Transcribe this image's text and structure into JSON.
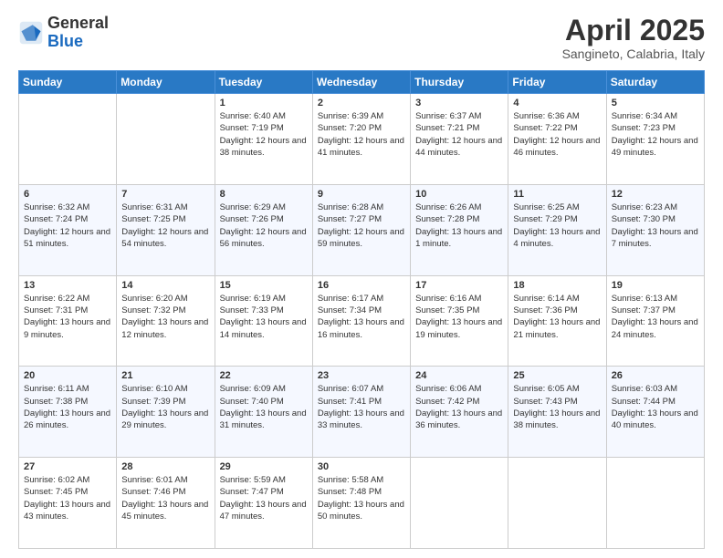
{
  "header": {
    "logo_general": "General",
    "logo_blue": "Blue",
    "title": "April 2025",
    "location": "Sangineto, Calabria, Italy"
  },
  "calendar": {
    "days_of_week": [
      "Sunday",
      "Monday",
      "Tuesday",
      "Wednesday",
      "Thursday",
      "Friday",
      "Saturday"
    ],
    "weeks": [
      [
        {
          "day": "",
          "content": ""
        },
        {
          "day": "",
          "content": ""
        },
        {
          "day": "1",
          "content": "Sunrise: 6:40 AM\nSunset: 7:19 PM\nDaylight: 12 hours and 38 minutes."
        },
        {
          "day": "2",
          "content": "Sunrise: 6:39 AM\nSunset: 7:20 PM\nDaylight: 12 hours and 41 minutes."
        },
        {
          "day": "3",
          "content": "Sunrise: 6:37 AM\nSunset: 7:21 PM\nDaylight: 12 hours and 44 minutes."
        },
        {
          "day": "4",
          "content": "Sunrise: 6:36 AM\nSunset: 7:22 PM\nDaylight: 12 hours and 46 minutes."
        },
        {
          "day": "5",
          "content": "Sunrise: 6:34 AM\nSunset: 7:23 PM\nDaylight: 12 hours and 49 minutes."
        }
      ],
      [
        {
          "day": "6",
          "content": "Sunrise: 6:32 AM\nSunset: 7:24 PM\nDaylight: 12 hours and 51 minutes."
        },
        {
          "day": "7",
          "content": "Sunrise: 6:31 AM\nSunset: 7:25 PM\nDaylight: 12 hours and 54 minutes."
        },
        {
          "day": "8",
          "content": "Sunrise: 6:29 AM\nSunset: 7:26 PM\nDaylight: 12 hours and 56 minutes."
        },
        {
          "day": "9",
          "content": "Sunrise: 6:28 AM\nSunset: 7:27 PM\nDaylight: 12 hours and 59 minutes."
        },
        {
          "day": "10",
          "content": "Sunrise: 6:26 AM\nSunset: 7:28 PM\nDaylight: 13 hours and 1 minute."
        },
        {
          "day": "11",
          "content": "Sunrise: 6:25 AM\nSunset: 7:29 PM\nDaylight: 13 hours and 4 minutes."
        },
        {
          "day": "12",
          "content": "Sunrise: 6:23 AM\nSunset: 7:30 PM\nDaylight: 13 hours and 7 minutes."
        }
      ],
      [
        {
          "day": "13",
          "content": "Sunrise: 6:22 AM\nSunset: 7:31 PM\nDaylight: 13 hours and 9 minutes."
        },
        {
          "day": "14",
          "content": "Sunrise: 6:20 AM\nSunset: 7:32 PM\nDaylight: 13 hours and 12 minutes."
        },
        {
          "day": "15",
          "content": "Sunrise: 6:19 AM\nSunset: 7:33 PM\nDaylight: 13 hours and 14 minutes."
        },
        {
          "day": "16",
          "content": "Sunrise: 6:17 AM\nSunset: 7:34 PM\nDaylight: 13 hours and 16 minutes."
        },
        {
          "day": "17",
          "content": "Sunrise: 6:16 AM\nSunset: 7:35 PM\nDaylight: 13 hours and 19 minutes."
        },
        {
          "day": "18",
          "content": "Sunrise: 6:14 AM\nSunset: 7:36 PM\nDaylight: 13 hours and 21 minutes."
        },
        {
          "day": "19",
          "content": "Sunrise: 6:13 AM\nSunset: 7:37 PM\nDaylight: 13 hours and 24 minutes."
        }
      ],
      [
        {
          "day": "20",
          "content": "Sunrise: 6:11 AM\nSunset: 7:38 PM\nDaylight: 13 hours and 26 minutes."
        },
        {
          "day": "21",
          "content": "Sunrise: 6:10 AM\nSunset: 7:39 PM\nDaylight: 13 hours and 29 minutes."
        },
        {
          "day": "22",
          "content": "Sunrise: 6:09 AM\nSunset: 7:40 PM\nDaylight: 13 hours and 31 minutes."
        },
        {
          "day": "23",
          "content": "Sunrise: 6:07 AM\nSunset: 7:41 PM\nDaylight: 13 hours and 33 minutes."
        },
        {
          "day": "24",
          "content": "Sunrise: 6:06 AM\nSunset: 7:42 PM\nDaylight: 13 hours and 36 minutes."
        },
        {
          "day": "25",
          "content": "Sunrise: 6:05 AM\nSunset: 7:43 PM\nDaylight: 13 hours and 38 minutes."
        },
        {
          "day": "26",
          "content": "Sunrise: 6:03 AM\nSunset: 7:44 PM\nDaylight: 13 hours and 40 minutes."
        }
      ],
      [
        {
          "day": "27",
          "content": "Sunrise: 6:02 AM\nSunset: 7:45 PM\nDaylight: 13 hours and 43 minutes."
        },
        {
          "day": "28",
          "content": "Sunrise: 6:01 AM\nSunset: 7:46 PM\nDaylight: 13 hours and 45 minutes."
        },
        {
          "day": "29",
          "content": "Sunrise: 5:59 AM\nSunset: 7:47 PM\nDaylight: 13 hours and 47 minutes."
        },
        {
          "day": "30",
          "content": "Sunrise: 5:58 AM\nSunset: 7:48 PM\nDaylight: 13 hours and 50 minutes."
        },
        {
          "day": "",
          "content": ""
        },
        {
          "day": "",
          "content": ""
        },
        {
          "day": "",
          "content": ""
        }
      ]
    ]
  }
}
